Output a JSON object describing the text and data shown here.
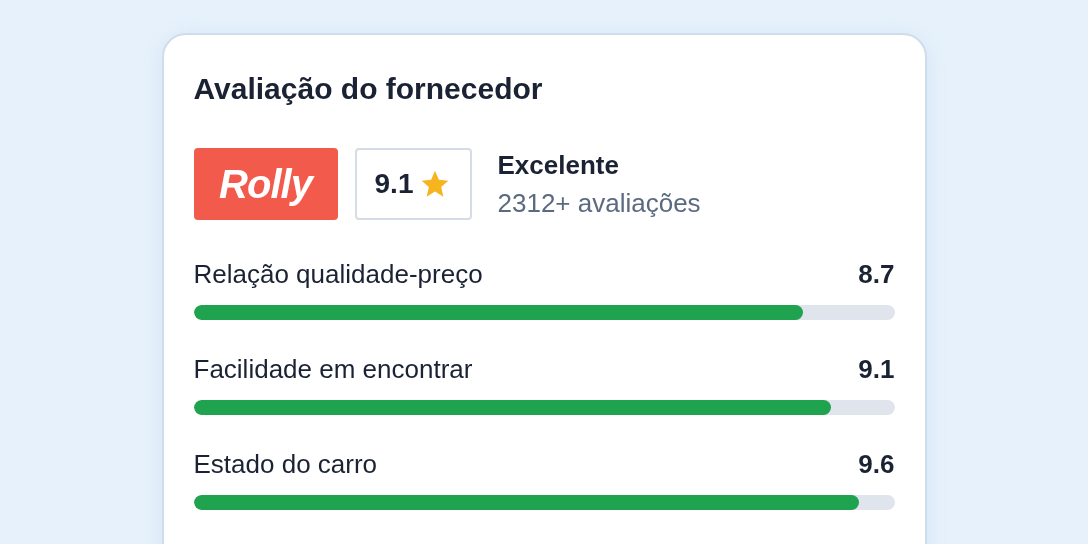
{
  "card": {
    "title": "Avaliação do fornecedor"
  },
  "supplier": {
    "logo": "Rolly",
    "score": "9.1",
    "verdict": "Excelente",
    "reviews": "2312+ avaliações"
  },
  "criteria": [
    {
      "label": "Relação qualidade-preço",
      "reading": "8.7",
      "level": 0.87
    },
    {
      "label": "Facilidade em encontrar",
      "reading": "9.1",
      "level": 0.91
    },
    {
      "label": "Estado do carro",
      "reading": "9.6",
      "level": 0.95
    }
  ]
}
